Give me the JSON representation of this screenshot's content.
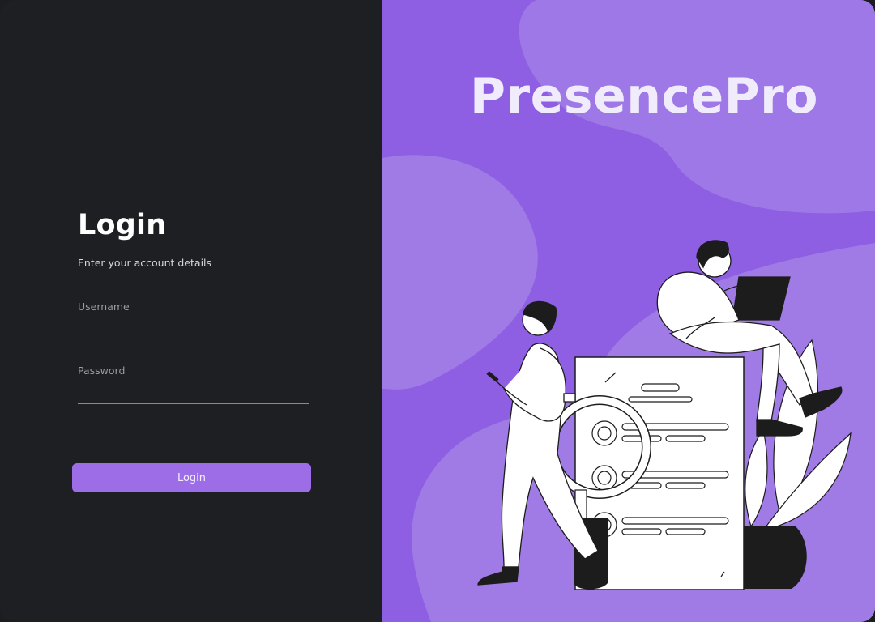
{
  "login_panel": {
    "title": "Login",
    "subtitle": "Enter your account details",
    "username_label": "Username",
    "username_value": "",
    "password_label": "Password",
    "password_value": "",
    "submit_label": "Login"
  },
  "hero": {
    "brand": "PresencePro",
    "illustration_icon": "people-with-documents-illustration"
  },
  "colors": {
    "left_bg": "#1e1f23",
    "right_bg": "#8f5fe3",
    "accent": "#9d6de8",
    "blob": "#a07be6"
  }
}
